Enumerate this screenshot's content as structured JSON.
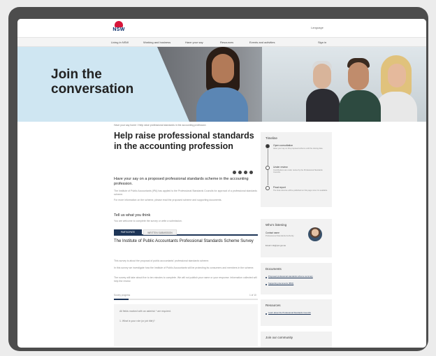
{
  "header": {
    "logo_text": "NSW",
    "language": "Language",
    "nav": [
      "Living in NSW",
      "Working and business",
      "Have your say",
      "Resources",
      "Events and activities"
    ],
    "sign_in": "Sign in"
  },
  "hero": {
    "title": "Join the\nconversation"
  },
  "breadcrumb": "Have your say home / Help raise professional standards in the accounting profession",
  "main": {
    "title": "Help raise professional standards in the accounting profession",
    "intro_heading": "Have your say on a proposed professional standards scheme in the accounting profession.",
    "intro_p1": "The Institute of Public Accountants (IPA) has applied to the Professional Standards Councils for approval of a professional standards scheme.",
    "intro_p2": "For more information on the scheme, please read the proposed scheme and supporting documents.",
    "tell_heading": "Tell us what you think",
    "tell_p": "You are welcome to complete the survey or write a submission.",
    "tabs": [
      "PARTICIPATE",
      "WRITTEN SUBMISSION"
    ],
    "survey_title": "The Institute of Public Accountants Professional Standards Scheme Survey",
    "survey_p1": "This survey is about the proposal of public accountants' professional standards scheme.",
    "survey_p2": "In this survey we investigate how the Institute of Public Accountants will be protecting its consumers and members in the scheme.",
    "survey_p3": "The survey will take about five to ten minutes to complete. We will not publish your name or your response. Information collected will help the review.",
    "progress_label": "Survey progress",
    "progress_count": "1 of 10",
    "progress": 0.1,
    "q_intro": "All fields marked with an asterisk * are required.",
    "q1": "1.   What is your role (or job title)?"
  },
  "sidebar": {
    "timeline": {
      "heading": "Timeline",
      "steps": [
        {
          "title": "Open consultation",
          "desc": "Have your say on this proposed scheme until the closing date.",
          "active": true
        },
        {
          "title": "Under review",
          "desc": "Contributions are under review by the Professional Standards Councils.",
          "active": false
        },
        {
          "title": "Final report",
          "desc": "The final outcome will be published on this page once it is available.",
          "active": false
        }
      ]
    },
    "contact": {
      "heading": "Who's listening",
      "name": "Contact name",
      "role": "Professional Standards Authority",
      "email": "Email: info@psc.gov.au"
    },
    "documents": {
      "heading": "Documents",
      "links": [
        "Proposed professional standards scheme summary",
        "Supporting documents (PDF)"
      ]
    },
    "resources": {
      "heading": "Resources",
      "links": [
        "Learn about the Professional Standards Councils"
      ]
    },
    "community": {
      "heading": "Join our community"
    }
  }
}
